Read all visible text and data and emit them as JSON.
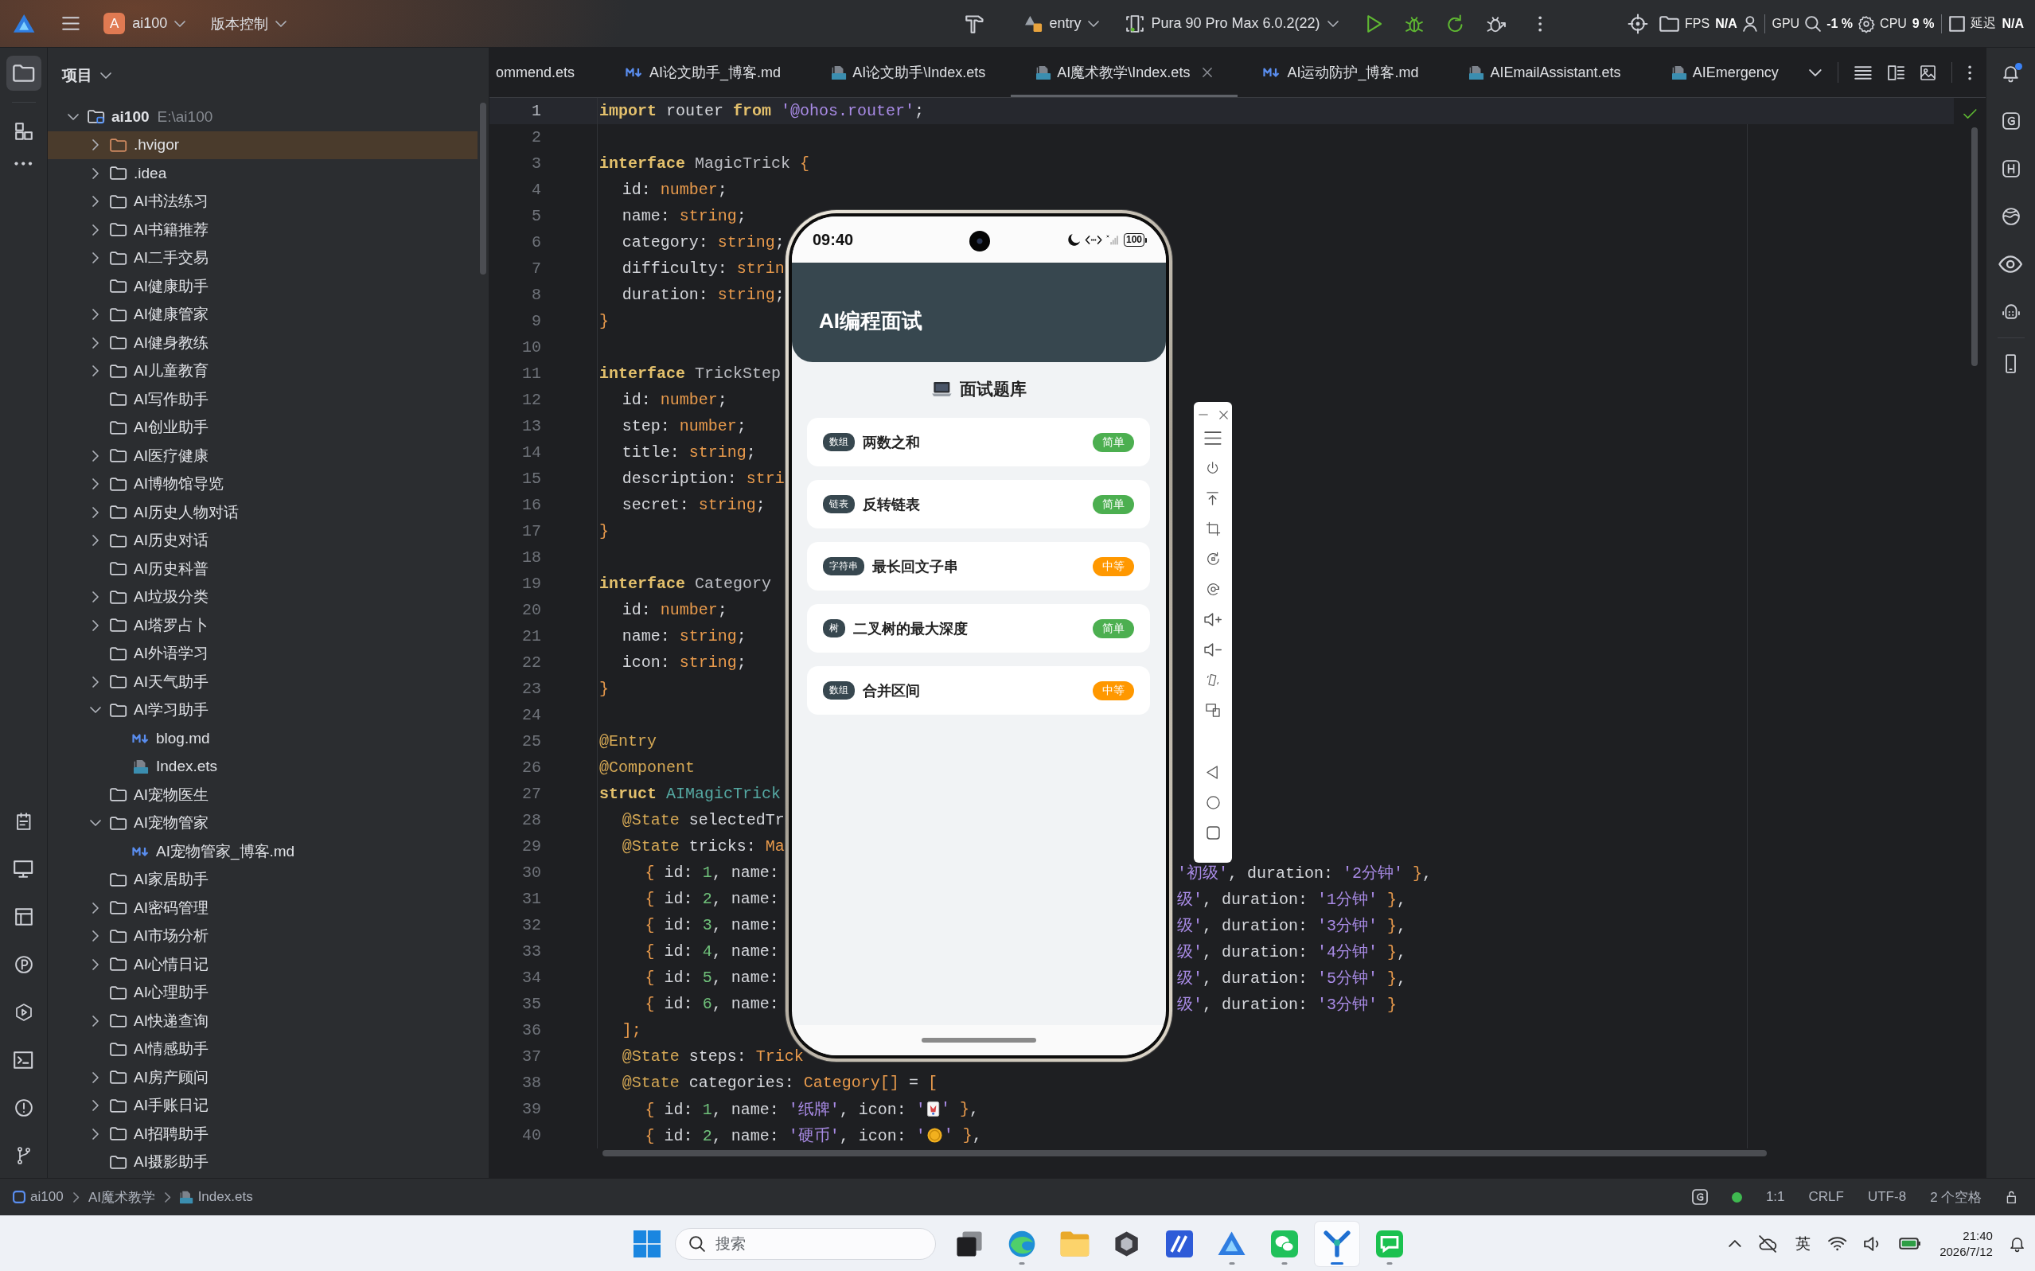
{
  "title_bar": {
    "project": {
      "badge": "A",
      "name": "ai100"
    },
    "vcs_menu": "版本控制",
    "module": "entry",
    "device": "Pura 90 Pro Max 6.0.2(22)"
  },
  "perf_overlay": [
    {
      "label": "FPS",
      "value": "N/A"
    },
    {
      "label": "GPU",
      "value": "-1 %"
    },
    {
      "label": "CPU",
      "value": "9 %"
    },
    {
      "label": "延迟",
      "value": "N/A"
    }
  ],
  "tool_windows": {
    "top": [
      {
        "selected": true
      },
      {
        "selected": false
      }
    ],
    "bottom": [
      {
        "selected": false
      },
      {
        "selected": false
      },
      {
        "selected": false
      },
      {
        "selected": false
      },
      {
        "selected": false
      },
      {
        "selected": false
      },
      {
        "selected": false
      },
      {
        "selected": false
      }
    ]
  },
  "project_panel": {
    "title": "项目",
    "tree": [
      {
        "name": "ai100",
        "path": "E:\\ai100",
        "kind": "module",
        "expanded": true,
        "selected": false,
        "children": [
          {
            "name": ".hvigor",
            "kind": "excluded-folder",
            "expanded": false,
            "selected": true
          },
          {
            "name": ".idea",
            "kind": "folder",
            "expanded": false,
            "selected": false
          },
          {
            "name": "AI书法练习",
            "kind": "folder",
            "expanded": false,
            "selected": false
          },
          {
            "name": "AI书籍推荐",
            "kind": "folder",
            "expanded": false,
            "selected": false
          },
          {
            "name": "AI二手交易",
            "kind": "folder",
            "expanded": false,
            "selected": false
          },
          {
            "name": "AI健康助手",
            "kind": "folder",
            "selected": false
          },
          {
            "name": "AI健康管家",
            "kind": "folder",
            "expanded": false,
            "selected": false
          },
          {
            "name": "AI健身教练",
            "kind": "folder",
            "expanded": false,
            "selected": false
          },
          {
            "name": "AI儿童教育",
            "kind": "folder",
            "expanded": false,
            "selected": false
          },
          {
            "name": "AI写作助手",
            "kind": "folder",
            "selected": false
          },
          {
            "name": "AI创业助手",
            "kind": "folder",
            "selected": false
          },
          {
            "name": "AI医疗健康",
            "kind": "folder",
            "expanded": false,
            "selected": false
          },
          {
            "name": "AI博物馆导览",
            "kind": "folder",
            "expanded": false,
            "selected": false
          },
          {
            "name": "AI历史人物对话",
            "kind": "folder",
            "expanded": false,
            "selected": false
          },
          {
            "name": "AI历史对话",
            "kind": "folder",
            "expanded": false,
            "selected": false
          },
          {
            "name": "AI历史科普",
            "kind": "folder",
            "selected": false
          },
          {
            "name": "AI垃圾分类",
            "kind": "folder",
            "expanded": false,
            "selected": false
          },
          {
            "name": "AI塔罗占卜",
            "kind": "folder",
            "expanded": false,
            "selected": false
          },
          {
            "name": "AI外语学习",
            "kind": "folder",
            "selected": false
          },
          {
            "name": "AI天气助手",
            "kind": "folder",
            "expanded": false,
            "selected": false
          },
          {
            "name": "AI学习助手",
            "kind": "folder",
            "expanded": true,
            "selected": false,
            "children": [
              {
                "name": "blog.md",
                "kind": "markdown",
                "selected": false
              },
              {
                "name": "Index.ets",
                "kind": "ets",
                "selected": false
              }
            ]
          },
          {
            "name": "AI宠物医生",
            "kind": "folder",
            "selected": false
          },
          {
            "name": "AI宠物管家",
            "kind": "folder",
            "expanded": true,
            "selected": false,
            "children": [
              {
                "name": "AI宠物管家_博客.md",
                "kind": "markdown",
                "selected": false
              }
            ]
          },
          {
            "name": "AI家居助手",
            "kind": "folder",
            "selected": false
          },
          {
            "name": "AI密码管理",
            "kind": "folder",
            "expanded": false,
            "selected": false
          },
          {
            "name": "AI市场分析",
            "kind": "folder",
            "expanded": false,
            "selected": false
          },
          {
            "name": "AI心情日记",
            "kind": "folder",
            "expanded": false,
            "selected": false
          },
          {
            "name": "AI心理助手",
            "kind": "folder",
            "selected": false
          },
          {
            "name": "AI快递查询",
            "kind": "folder",
            "expanded": false,
            "selected": false
          },
          {
            "name": "AI情感助手",
            "kind": "folder",
            "selected": false
          },
          {
            "name": "AI房产顾问",
            "kind": "folder",
            "expanded": false,
            "selected": false
          },
          {
            "name": "AI手账日记",
            "kind": "folder",
            "expanded": false,
            "selected": false
          },
          {
            "name": "AI招聘助手",
            "kind": "folder",
            "expanded": false,
            "selected": false
          },
          {
            "name": "AI摄影助手",
            "kind": "folder",
            "selected": false
          }
        ]
      }
    ]
  },
  "editor": {
    "tabs": [
      {
        "label": "ommend.ets",
        "kind": "plain",
        "selected": false
      },
      {
        "label": "AI论文助手_博客.md",
        "kind": "markdown",
        "selected": false
      },
      {
        "label": "AI论文助手\\Index.ets",
        "kind": "ets",
        "selected": false
      },
      {
        "label": "AI魔术教学\\Index.ets",
        "kind": "ets",
        "selected": true
      },
      {
        "label": "AI运动防护_博客.md",
        "kind": "markdown",
        "selected": false
      },
      {
        "label": "AIEmailAssistant.ets",
        "kind": "ets",
        "selected": false
      },
      {
        "label": "AIEmergency",
        "kind": "ets",
        "selected": false
      }
    ],
    "lines": [
      {
        "number": "1",
        "current": true,
        "tokens": [
          {
            "kind": "keyword",
            "text": "import"
          },
          {
            "kind": "plain",
            "text": " router "
          },
          {
            "kind": "keyword",
            "text": "from "
          },
          {
            "kind": "string",
            "text": "'@ohos.router'"
          },
          {
            "kind": "plain",
            "text": ";"
          }
        ]
      },
      {
        "number": "2",
        "current": false
      },
      {
        "number": "3",
        "current": false,
        "tokens": [
          {
            "kind": "keyword",
            "text": "interface "
          },
          {
            "kind": "class",
            "text": "MagicTrick "
          },
          {
            "kind": "bracket",
            "text": "{"
          }
        ]
      },
      {
        "number": "4",
        "current": false,
        "tokens": [
          {
            "kind": "indent"
          },
          {
            "kind": "plain",
            "text": "id: "
          },
          {
            "kind": "type",
            "text": "number"
          },
          {
            "kind": "plain",
            "text": ";"
          }
        ]
      },
      {
        "number": "5",
        "current": false,
        "tokens": [
          {
            "kind": "indent"
          },
          {
            "kind": "plain",
            "text": "name: "
          },
          {
            "kind": "type",
            "text": "string"
          },
          {
            "kind": "plain",
            "text": ";"
          }
        ]
      },
      {
        "number": "6",
        "current": false,
        "tokens": [
          {
            "kind": "indent"
          },
          {
            "kind": "plain",
            "text": "category: "
          },
          {
            "kind": "type",
            "text": "string"
          },
          {
            "kind": "plain",
            "text": ";"
          }
        ]
      },
      {
        "number": "7",
        "current": false,
        "tokens": [
          {
            "kind": "indent"
          },
          {
            "kind": "plain",
            "text": "difficulty: "
          },
          {
            "kind": "type",
            "text": "strin"
          }
        ]
      },
      {
        "number": "8",
        "current": false,
        "tokens": [
          {
            "kind": "indent"
          },
          {
            "kind": "plain",
            "text": "duration: "
          },
          {
            "kind": "type",
            "text": "string"
          },
          {
            "kind": "plain",
            "text": ";"
          }
        ]
      },
      {
        "number": "9",
        "current": false,
        "tokens": [
          {
            "kind": "bracket",
            "text": "}"
          }
        ]
      },
      {
        "number": "10",
        "current": false
      },
      {
        "number": "11",
        "current": false,
        "tokens": [
          {
            "kind": "keyword",
            "text": "interface "
          },
          {
            "kind": "class",
            "text": "TrickStep"
          }
        ]
      },
      {
        "number": "12",
        "current": false,
        "tokens": [
          {
            "kind": "indent"
          },
          {
            "kind": "plain",
            "text": "id: "
          },
          {
            "kind": "type",
            "text": "number"
          },
          {
            "kind": "plain",
            "text": ";"
          }
        ]
      },
      {
        "number": "13",
        "current": false,
        "tokens": [
          {
            "kind": "indent"
          },
          {
            "kind": "plain",
            "text": "step: "
          },
          {
            "kind": "type",
            "text": "number"
          },
          {
            "kind": "plain",
            "text": ";"
          }
        ]
      },
      {
        "number": "14",
        "current": false,
        "tokens": [
          {
            "kind": "indent"
          },
          {
            "kind": "plain",
            "text": "title: "
          },
          {
            "kind": "type",
            "text": "string"
          },
          {
            "kind": "plain",
            "text": ";"
          }
        ]
      },
      {
        "number": "15",
        "current": false,
        "tokens": [
          {
            "kind": "indent"
          },
          {
            "kind": "plain",
            "text": "description: "
          },
          {
            "kind": "type",
            "text": "stri"
          }
        ]
      },
      {
        "number": "16",
        "current": false,
        "tokens": [
          {
            "kind": "indent"
          },
          {
            "kind": "plain",
            "text": "secret: "
          },
          {
            "kind": "type",
            "text": "string"
          },
          {
            "kind": "plain",
            "text": ";"
          }
        ]
      },
      {
        "number": "17",
        "current": false,
        "tokens": [
          {
            "kind": "bracket",
            "text": "}"
          }
        ]
      },
      {
        "number": "18",
        "current": false
      },
      {
        "number": "19",
        "current": false,
        "tokens": [
          {
            "kind": "keyword",
            "text": "interface "
          },
          {
            "kind": "class",
            "text": "Category"
          }
        ]
      },
      {
        "number": "20",
        "current": false,
        "tokens": [
          {
            "kind": "indent"
          },
          {
            "kind": "plain",
            "text": "id: "
          },
          {
            "kind": "type",
            "text": "number"
          },
          {
            "kind": "plain",
            "text": ";"
          }
        ]
      },
      {
        "number": "21",
        "current": false,
        "tokens": [
          {
            "kind": "indent"
          },
          {
            "kind": "plain",
            "text": "name: "
          },
          {
            "kind": "type",
            "text": "string"
          },
          {
            "kind": "plain",
            "text": ";"
          }
        ]
      },
      {
        "number": "22",
        "current": false,
        "tokens": [
          {
            "kind": "indent"
          },
          {
            "kind": "plain",
            "text": "icon: "
          },
          {
            "kind": "type",
            "text": "string"
          },
          {
            "kind": "plain",
            "text": ";"
          }
        ]
      },
      {
        "number": "23",
        "current": false,
        "tokens": [
          {
            "kind": "bracket",
            "text": "}"
          }
        ]
      },
      {
        "number": "24",
        "current": false
      },
      {
        "number": "25",
        "current": false,
        "tokens": [
          {
            "kind": "decorator",
            "text": "@Entry"
          }
        ]
      },
      {
        "number": "26",
        "current": false,
        "tokens": [
          {
            "kind": "decorator",
            "text": "@Component"
          }
        ]
      },
      {
        "number": "27",
        "current": false,
        "tokens": [
          {
            "kind": "keyword",
            "text": "struct "
          },
          {
            "kind": "struct",
            "text": "AIMagicTrick"
          }
        ]
      },
      {
        "number": "28",
        "current": false,
        "tokens": [
          {
            "kind": "indent"
          },
          {
            "kind": "decorator",
            "text": "@State"
          },
          {
            "kind": "plain",
            "text": " selectedTr"
          }
        ]
      },
      {
        "number": "29",
        "current": false,
        "tokens": [
          {
            "kind": "indent"
          },
          {
            "kind": "decorator",
            "text": "@State"
          },
          {
            "kind": "plain",
            "text": " tricks: "
          },
          {
            "kind": "type",
            "text": "Ma"
          }
        ]
      },
      {
        "number": "30",
        "current": false,
        "tokens": [
          {
            "kind": "indent"
          },
          {
            "kind": "indent"
          },
          {
            "kind": "bracket",
            "text": "{"
          },
          {
            "kind": "plain",
            "text": " id: "
          },
          {
            "kind": "number",
            "text": "1"
          },
          {
            "kind": "plain",
            "text": ", name:"
          }
        ],
        "right_fragment": [
          {
            "kind": "string",
            "text": "'初级'"
          },
          {
            "kind": "plain",
            "text": ", duration: "
          },
          {
            "kind": "string",
            "text": "'2分钟'"
          },
          {
            "kind": "bracket",
            "text": " }"
          },
          {
            "kind": "plain",
            "text": ","
          }
        ]
      },
      {
        "number": "31",
        "current": false,
        "tokens": [
          {
            "kind": "indent"
          },
          {
            "kind": "indent"
          },
          {
            "kind": "bracket",
            "text": "{"
          },
          {
            "kind": "plain",
            "text": " id: "
          },
          {
            "kind": "number",
            "text": "2"
          },
          {
            "kind": "plain",
            "text": ", name:"
          }
        ],
        "right_fragment": [
          {
            "kind": "string",
            "text": "级'"
          },
          {
            "kind": "plain",
            "text": ", duration: "
          },
          {
            "kind": "string",
            "text": "'1分钟'"
          },
          {
            "kind": "bracket",
            "text": " }"
          },
          {
            "kind": "plain",
            "text": ","
          }
        ]
      },
      {
        "number": "32",
        "current": false,
        "tokens": [
          {
            "kind": "indent"
          },
          {
            "kind": "indent"
          },
          {
            "kind": "bracket",
            "text": "{"
          },
          {
            "kind": "plain",
            "text": " id: "
          },
          {
            "kind": "number",
            "text": "3"
          },
          {
            "kind": "plain",
            "text": ", name:"
          }
        ],
        "right_fragment": [
          {
            "kind": "string",
            "text": "级'"
          },
          {
            "kind": "plain",
            "text": ", duration: "
          },
          {
            "kind": "string",
            "text": "'3分钟'"
          },
          {
            "kind": "bracket",
            "text": " }"
          },
          {
            "kind": "plain",
            "text": ","
          }
        ]
      },
      {
        "number": "33",
        "current": false,
        "tokens": [
          {
            "kind": "indent"
          },
          {
            "kind": "indent"
          },
          {
            "kind": "bracket",
            "text": "{"
          },
          {
            "kind": "plain",
            "text": " id: "
          },
          {
            "kind": "number",
            "text": "4"
          },
          {
            "kind": "plain",
            "text": ", name:"
          }
        ],
        "right_fragment": [
          {
            "kind": "string",
            "text": "级'"
          },
          {
            "kind": "plain",
            "text": ", duration: "
          },
          {
            "kind": "string",
            "text": "'4分钟'"
          },
          {
            "kind": "bracket",
            "text": " }"
          },
          {
            "kind": "plain",
            "text": ","
          }
        ]
      },
      {
        "number": "34",
        "current": false,
        "tokens": [
          {
            "kind": "indent"
          },
          {
            "kind": "indent"
          },
          {
            "kind": "bracket",
            "text": "{"
          },
          {
            "kind": "plain",
            "text": " id: "
          },
          {
            "kind": "number",
            "text": "5"
          },
          {
            "kind": "plain",
            "text": ", name:"
          }
        ],
        "right_fragment": [
          {
            "kind": "string",
            "text": "级'"
          },
          {
            "kind": "plain",
            "text": ", duration: "
          },
          {
            "kind": "string",
            "text": "'5分钟'"
          },
          {
            "kind": "bracket",
            "text": " }"
          },
          {
            "kind": "plain",
            "text": ","
          }
        ]
      },
      {
        "number": "35",
        "current": false,
        "tokens": [
          {
            "kind": "indent"
          },
          {
            "kind": "indent"
          },
          {
            "kind": "bracket",
            "text": "{"
          },
          {
            "kind": "plain",
            "text": " id: "
          },
          {
            "kind": "number",
            "text": "6"
          },
          {
            "kind": "plain",
            "text": ", name:"
          }
        ],
        "right_fragment": [
          {
            "kind": "string",
            "text": "级'"
          },
          {
            "kind": "plain",
            "text": ", duration: "
          },
          {
            "kind": "string",
            "text": "'3分钟'"
          },
          {
            "kind": "bracket",
            "text": " }"
          }
        ]
      },
      {
        "number": "36",
        "current": false,
        "tokens": [
          {
            "kind": "indent"
          },
          {
            "kind": "bracket",
            "text": "];"
          }
        ]
      },
      {
        "number": "37",
        "current": false,
        "tokens": [
          {
            "kind": "indent"
          },
          {
            "kind": "decorator",
            "text": "@State"
          },
          {
            "kind": "plain",
            "text": " steps: "
          },
          {
            "kind": "type",
            "text": "Trick"
          }
        ]
      },
      {
        "number": "38",
        "current": false,
        "tokens": [
          {
            "kind": "indent"
          },
          {
            "kind": "decorator",
            "text": "@State"
          },
          {
            "kind": "plain",
            "text": " categories: "
          },
          {
            "kind": "type",
            "text": "Category[]"
          },
          {
            "kind": "plain",
            "text": " = "
          },
          {
            "kind": "bracket",
            "text": "["
          }
        ]
      },
      {
        "number": "39",
        "current": false,
        "tokens": [
          {
            "kind": "indent"
          },
          {
            "kind": "indent"
          },
          {
            "kind": "bracket",
            "text": "{"
          },
          {
            "kind": "plain",
            "text": " id: "
          },
          {
            "kind": "number",
            "text": "1"
          },
          {
            "kind": "plain",
            "text": ", name: "
          },
          {
            "kind": "string",
            "text": "'纸牌'"
          },
          {
            "kind": "plain",
            "text": ", icon: "
          },
          {
            "kind": "string",
            "text": "'"
          },
          {
            "kind": "emoji"
          },
          {
            "kind": "string",
            "text": "'"
          },
          {
            "kind": "bracket",
            "text": " }"
          },
          {
            "kind": "plain",
            "text": ","
          }
        ]
      },
      {
        "number": "40",
        "current": false,
        "tokens": [
          {
            "kind": "indent"
          },
          {
            "kind": "indent"
          },
          {
            "kind": "bracket",
            "text": "{"
          },
          {
            "kind": "plain",
            "text": " id: "
          },
          {
            "kind": "number",
            "text": "2"
          },
          {
            "kind": "plain",
            "text": ", name: "
          },
          {
            "kind": "string",
            "text": "'硬币'"
          },
          {
            "kind": "plain",
            "text": ", icon: "
          },
          {
            "kind": "string",
            "text": "'"
          },
          {
            "kind": "emoji"
          },
          {
            "kind": "string",
            "text": "'"
          },
          {
            "kind": "bracket",
            "text": " }"
          },
          {
            "kind": "plain",
            "text": ","
          }
        ]
      }
    ]
  },
  "phone": {
    "status_bar": {
      "time": "09:40",
      "battery": "100"
    },
    "app_bar": {
      "title": "AI编程面试"
    },
    "section_title": "面试题库",
    "problems": [
      {
        "tag": "数组",
        "title": "两数之和",
        "difficulty": "简单",
        "color": "#4caf50"
      },
      {
        "tag": "链表",
        "title": "反转链表",
        "difficulty": "简单",
        "color": "#4caf50"
      },
      {
        "tag": "字符串",
        "title": "最长回文子串",
        "difficulty": "中等",
        "color": "#ff9800"
      },
      {
        "tag": "树",
        "title": "二叉树的最大深度",
        "difficulty": "简单",
        "color": "#4caf50"
      },
      {
        "tag": "数组",
        "title": "合并区间",
        "difficulty": "中等",
        "color": "#ff9800"
      }
    ]
  },
  "notifications": {
    "unread": true
  },
  "status_bar": {
    "breadcrumbs": [
      {
        "label": "ai100",
        "kind": "module"
      },
      {
        "label": "AI魔术教学",
        "kind": "folder"
      },
      {
        "label": "Index.ets",
        "kind": "ets"
      }
    ],
    "caret_position": "1:1",
    "line_separator": "CRLF",
    "encoding": "UTF-8",
    "indent": "2 个空格"
  },
  "taskbar": {
    "search": {
      "placeholder": "搜索"
    },
    "apps": [
      {
        "running": false,
        "selected": false
      },
      {
        "running": true,
        "selected": false
      },
      {
        "running": false,
        "selected": false
      },
      {
        "running": false,
        "selected": false
      },
      {
        "running": false,
        "selected": false
      },
      {
        "running": true,
        "selected": false
      },
      {
        "running": true,
        "selected": false
      },
      {
        "running": true,
        "selected": true
      },
      {
        "running": true,
        "selected": false
      }
    ],
    "input_method": "英",
    "time": "21:40",
    "date": "2026/7/12"
  }
}
